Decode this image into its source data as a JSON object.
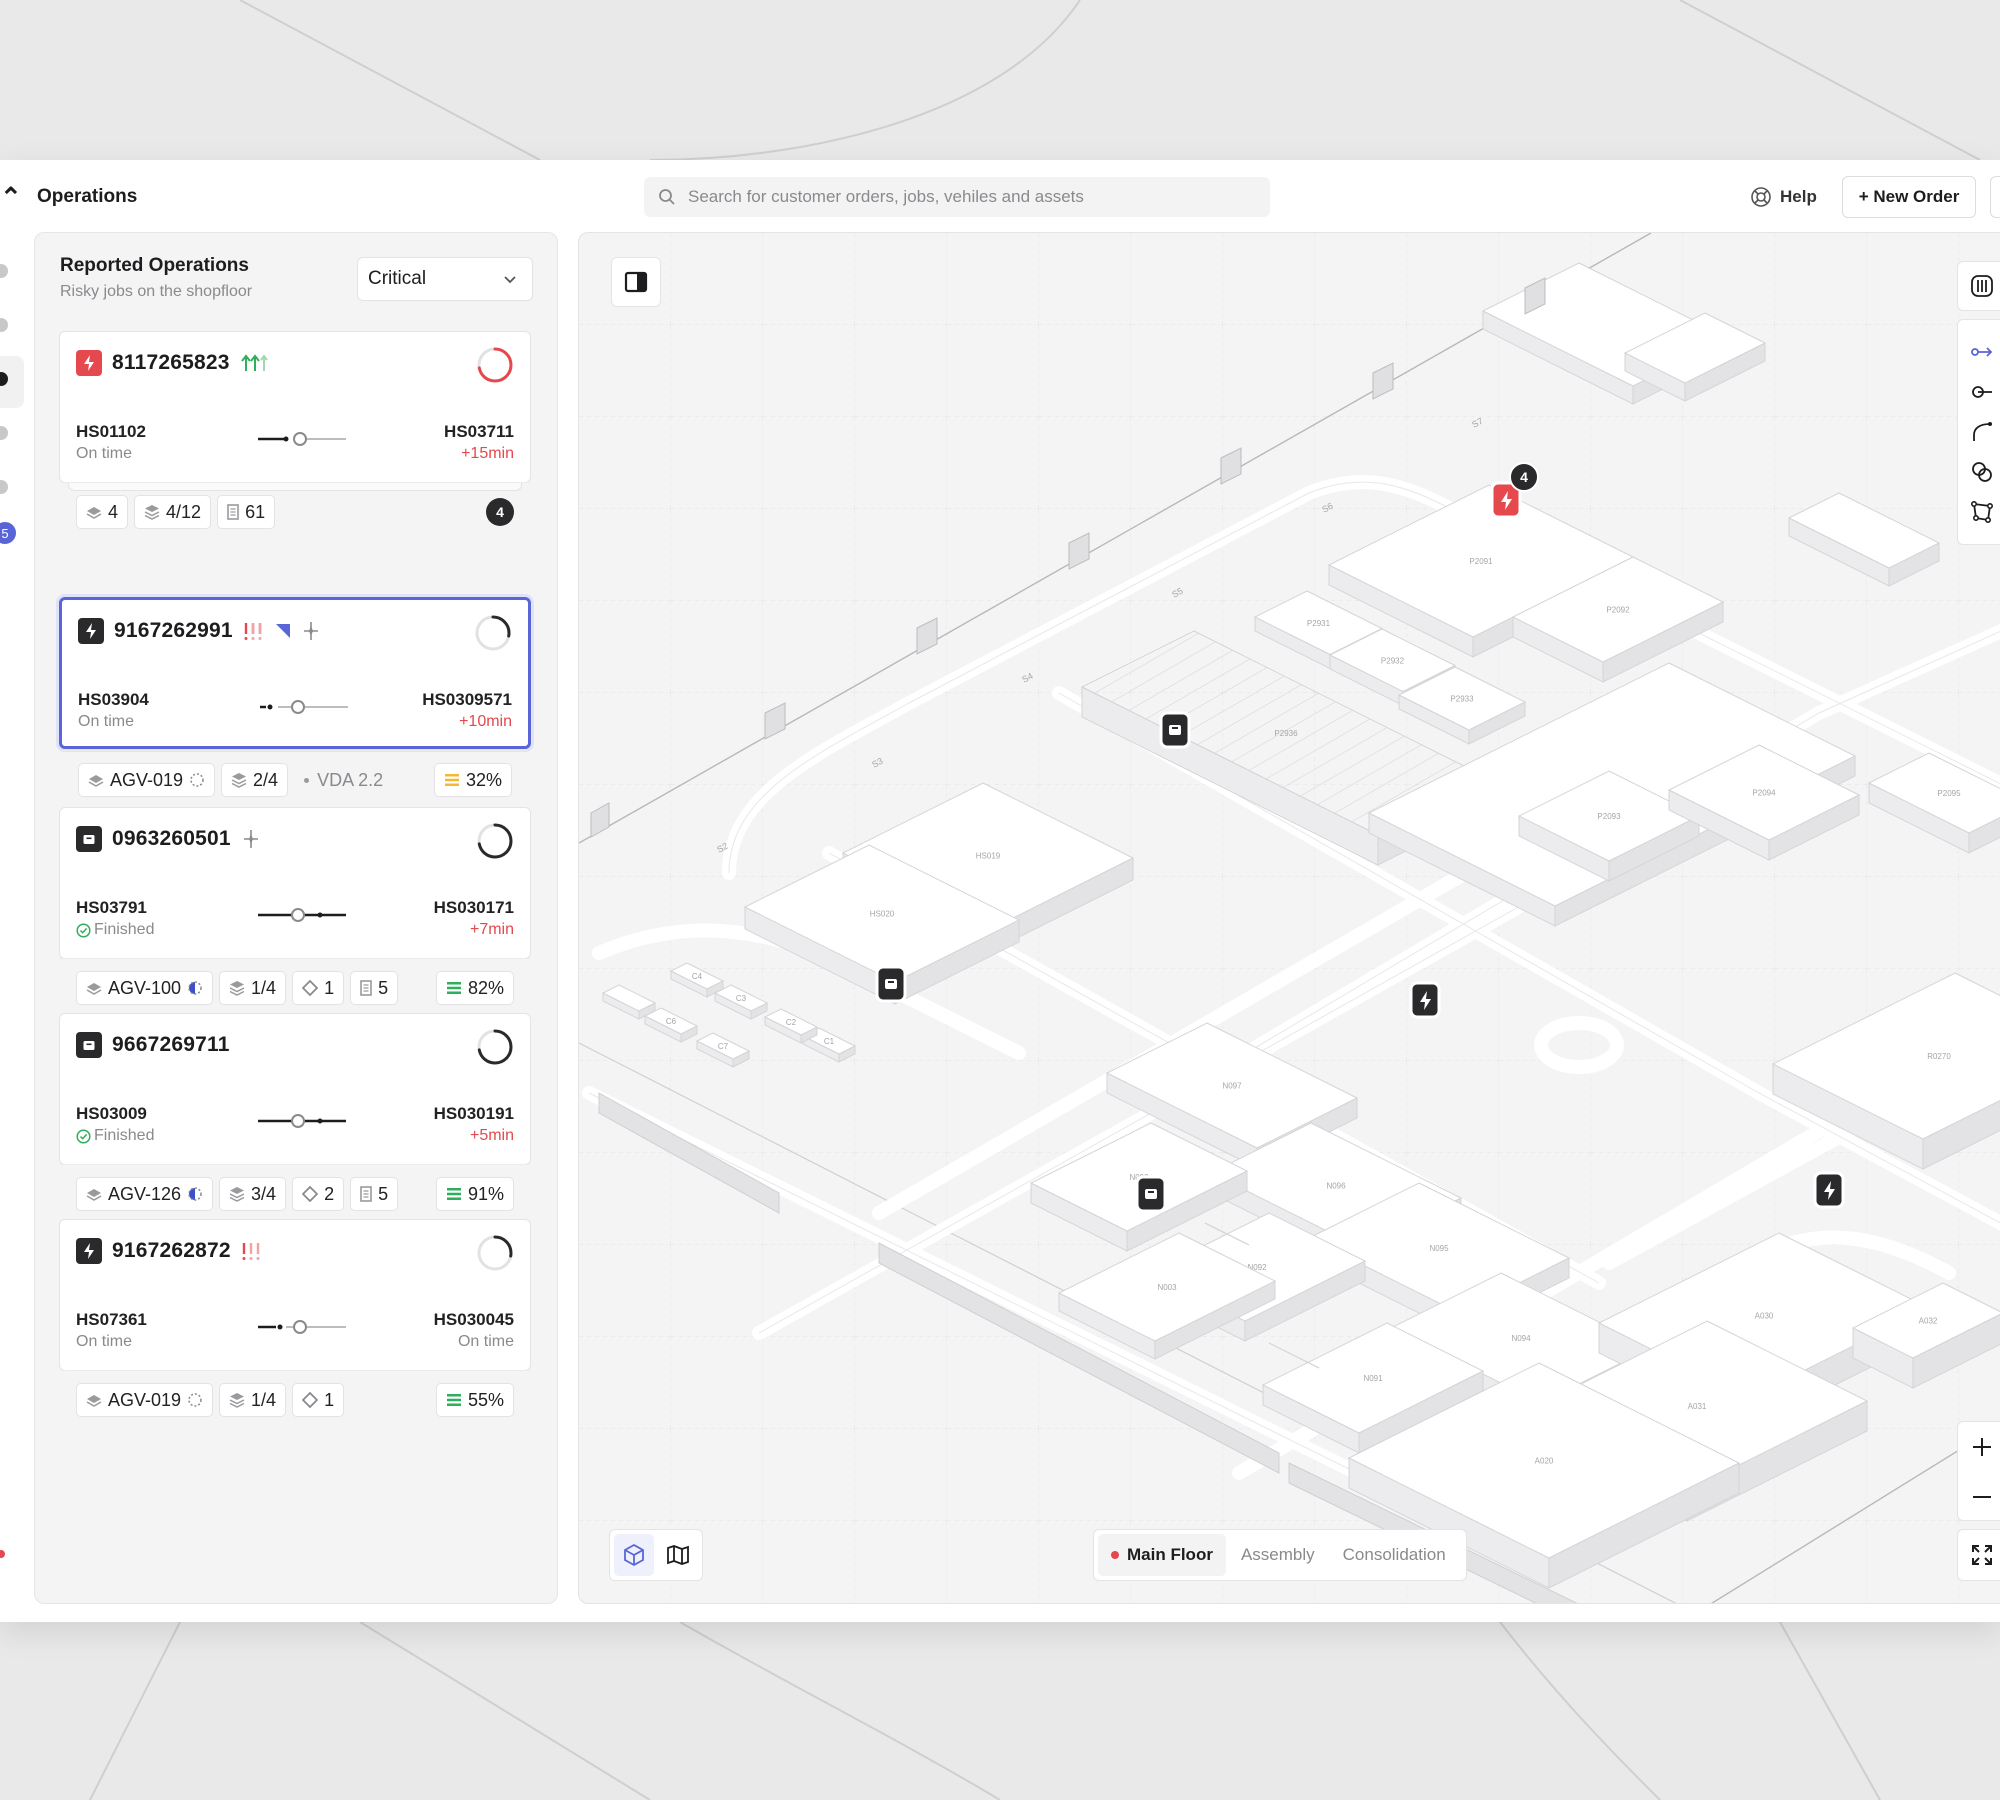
{
  "app": {
    "page_title": "Operations",
    "search_placeholder": "Search for customer orders, jobs, vehiles and assets",
    "help_label": "Help",
    "new_order_label": "+ New Order",
    "rail_badge": "5"
  },
  "panel": {
    "title": "Reported Operations",
    "subtitle": "Risky jobs on the shopfloor",
    "filter_value": "Critical"
  },
  "jobs": [
    {
      "id": "8117265823",
      "type": "charging",
      "type_color": "#e5484d",
      "progress": 0.72,
      "from_code": "HS01102",
      "from_status": "On time",
      "to_code": "HS03711",
      "to_status": "+15min",
      "chips": [
        "4",
        "4/12",
        "61"
      ],
      "badge": "4"
    },
    {
      "id": "9167262991",
      "type": "charging",
      "type_color": "#2a2a2c",
      "progress": 0.28,
      "from_code": "HS03904",
      "from_status": "On time",
      "to_code": "HS0309571",
      "to_status": "+10min",
      "chips": [
        "AGV-019",
        "2/4"
      ],
      "vda": "VDA 2.2",
      "battery": "32%",
      "battery_color": "#f5b833"
    },
    {
      "id": "0963260501",
      "type": "package",
      "type_color": "#2a2a2c",
      "progress": 0.72,
      "from_code": "HS03791",
      "from_status": "Finished",
      "to_code": "HS030171",
      "to_status": "+7min",
      "chips": [
        "AGV-100",
        "1/4",
        "1",
        "5"
      ],
      "battery": "82%",
      "battery_color": "#2fae5b"
    },
    {
      "id": "9667269711",
      "type": "package",
      "type_color": "#2a2a2c",
      "progress": 0.72,
      "from_code": "HS03009",
      "from_status": "Finished",
      "to_code": "HS030191",
      "to_status": "+5min",
      "chips": [
        "AGV-126",
        "3/4",
        "2",
        "5"
      ],
      "battery": "91%",
      "battery_color": "#2fae5b"
    },
    {
      "id": "9167262872",
      "type": "charging",
      "type_color": "#2a2a2c",
      "progress": 0.28,
      "from_code": "HS07361",
      "from_status": "On time",
      "to_code": "HS030045",
      "to_status": "On time",
      "chips": [
        "AGV-019",
        "1/4",
        "1"
      ],
      "battery": "55%",
      "battery_color": "#2fae5b"
    }
  ],
  "map": {
    "floor_tabs": [
      "Main Floor",
      "Assembly",
      "Consolidation"
    ],
    "active_floor": "Main Floor",
    "marker_count": "4",
    "zone_labels": [
      "S2",
      "S3",
      "S4",
      "S5",
      "S6",
      "S7",
      "P2091",
      "P2092",
      "P2931",
      "P2932",
      "P2933",
      "P2936",
      "P2096",
      "P2093",
      "P2095",
      "P2094",
      "HS019",
      "HS020",
      "C1",
      "C2",
      "C3",
      "C4",
      "C6",
      "C7",
      "N097",
      "N096",
      "N093",
      "N095",
      "N094",
      "N092",
      "N091",
      "N003",
      "R0270",
      "A030",
      "A032",
      "A031",
      "A020"
    ]
  }
}
